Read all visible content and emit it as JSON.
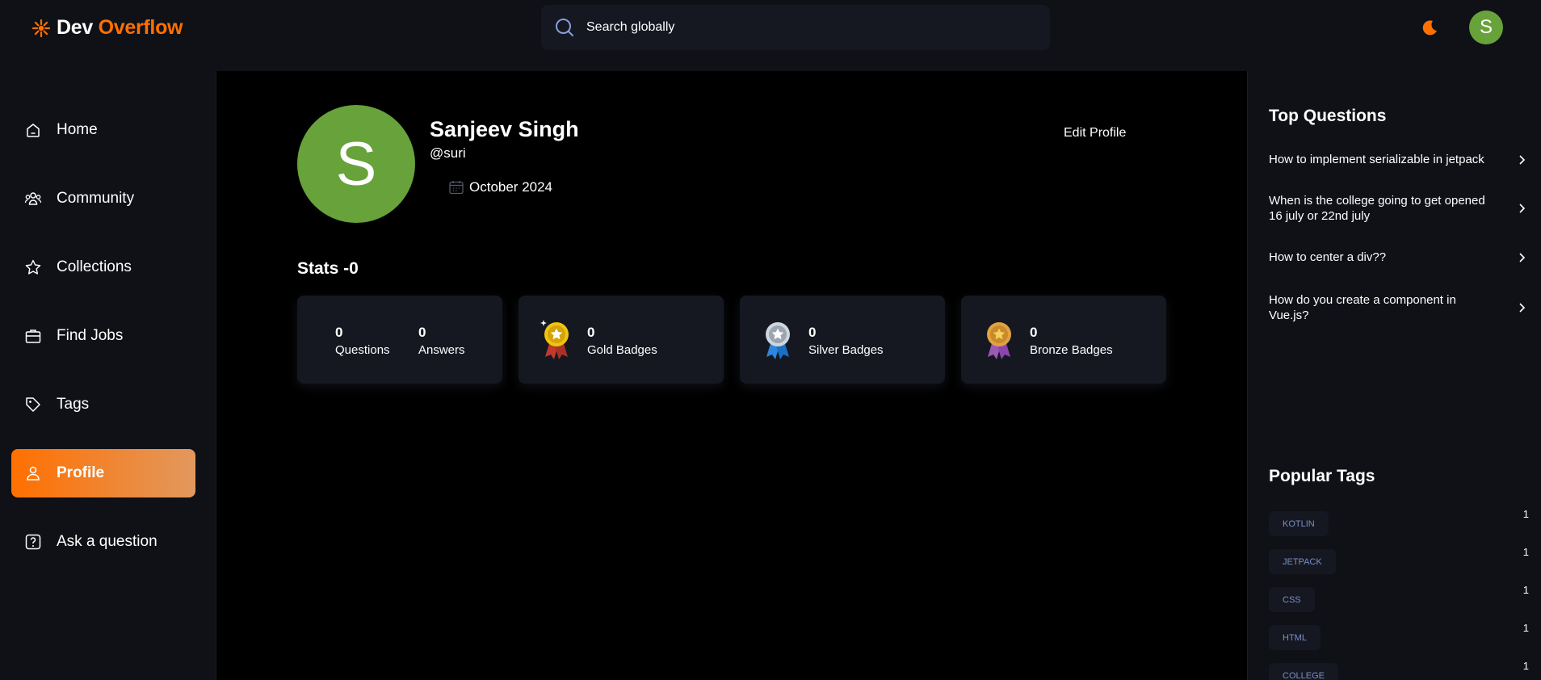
{
  "app": {
    "brand_first": "Dev",
    "brand_second": "Overflow",
    "accent": "#ff7000"
  },
  "search": {
    "placeholder": "Search globally"
  },
  "header": {
    "avatar_initial": "S",
    "theme_icon": "moon-icon"
  },
  "sidebar": {
    "items": [
      {
        "label": "Home",
        "icon": "home-icon",
        "active": false
      },
      {
        "label": "Community",
        "icon": "users-icon",
        "active": false
      },
      {
        "label": "Collections",
        "icon": "star-icon",
        "active": false
      },
      {
        "label": "Find Jobs",
        "icon": "briefcase-icon",
        "active": false
      },
      {
        "label": "Tags",
        "icon": "tag-icon",
        "active": false
      },
      {
        "label": "Profile",
        "icon": "user-icon",
        "active": true
      },
      {
        "label": "Ask a question",
        "icon": "question-icon",
        "active": false
      }
    ]
  },
  "profile": {
    "initial": "S",
    "name": "Sanjeev Singh",
    "username": "@suri",
    "joined": "October 2024",
    "edit_label": "Edit Profile"
  },
  "stats": {
    "title": "Stats -0",
    "questions": {
      "value": "0",
      "label": "Questions"
    },
    "answers": {
      "value": "0",
      "label": "Answers"
    },
    "gold": {
      "value": "0",
      "label": "Gold Badges"
    },
    "silver": {
      "value": "0",
      "label": "Silver Badges"
    },
    "bronze": {
      "value": "0",
      "label": "Bronze Badges"
    }
  },
  "right_sidebar": {
    "top_questions_title": "Top Questions",
    "top_questions": [
      "How to implement serializable in jetpack",
      "When is the college going to get opened 16 july or 22nd july",
      "How to center a div??",
      "How do you create a component in Vue.js?"
    ],
    "popular_tags_title": "Popular Tags",
    "tags": [
      {
        "name": "KOTLIN",
        "count": "1"
      },
      {
        "name": "JETPACK",
        "count": "1"
      },
      {
        "name": "CSS",
        "count": "1"
      },
      {
        "name": "HTML",
        "count": "1"
      },
      {
        "name": "COLLEGE",
        "count": "1"
      }
    ]
  }
}
